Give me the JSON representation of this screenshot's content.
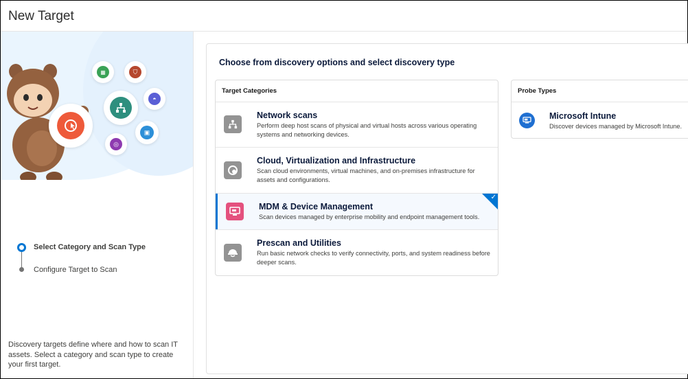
{
  "header": {
    "title": "New Target"
  },
  "sidebar": {
    "steps": [
      {
        "label": "Select Category and Scan Type",
        "active": true
      },
      {
        "label": "Configure Target to Scan",
        "active": false
      }
    ],
    "description": "Discovery targets define where and how to scan IT assets. Select a category and scan type to create your first target."
  },
  "main": {
    "title": "Choose from discovery options and select discovery type",
    "categories": {
      "heading": "Target Categories",
      "items": [
        {
          "title": "Network scans",
          "description": "Perform deep host scans of physical and virtual hosts across various operating systems and networking devices.",
          "icon": "network-icon",
          "icon_color": "#939393"
        },
        {
          "title": "Cloud, Virtualization and Infrastructure",
          "description": "Scan cloud environments, virtual machines, and on-premises infrastructure for assets and configurations.",
          "icon": "cloud-scan-icon",
          "icon_color": "#939393"
        },
        {
          "title": "MDM & Device Management",
          "description": "Scan devices managed by enterprise mobility and endpoint management tools.",
          "icon": "device-management-icon",
          "icon_color": "#e4517e",
          "selected": true
        },
        {
          "title": "Prescan and Utilities",
          "description": "Run basic network checks to verify connectivity, ports, and system readiness before deeper scans.",
          "icon": "hardhat-icon",
          "icon_color": "#939393"
        }
      ]
    },
    "probes": {
      "heading": "Probe Types",
      "items": [
        {
          "title": "Microsoft Intune",
          "description": "Discover devices managed by Microsoft Intune.",
          "icon": "intune-icon",
          "icon_color": "#1f6fd1"
        }
      ]
    }
  },
  "colors": {
    "accent": "#0176d3",
    "selected_bg": "#f5f9fe",
    "title_text": "#0b1a3b"
  }
}
